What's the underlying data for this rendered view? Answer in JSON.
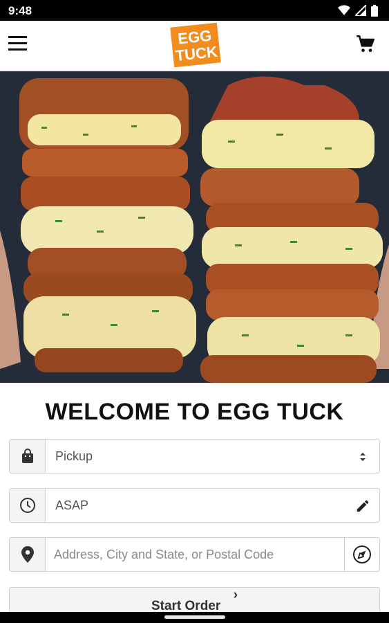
{
  "status_bar": {
    "time": "9:48"
  },
  "app_bar": {
    "logo_line1": "EGG",
    "logo_line2": "TUCK",
    "brand_color": "#F28C1E"
  },
  "main": {
    "welcome_title": "WELCOME TO EGG TUCK",
    "order_type": {
      "value": "Pickup",
      "icon": "shopping-bag-icon"
    },
    "time": {
      "value": "ASAP",
      "icon": "clock-icon",
      "edit_icon": "pencil-icon"
    },
    "location": {
      "placeholder": "Address, City and State, or Postal Code",
      "icon": "location-pin-icon",
      "action_icon": "navigation-icon"
    },
    "start_order_label": "Start Order"
  }
}
